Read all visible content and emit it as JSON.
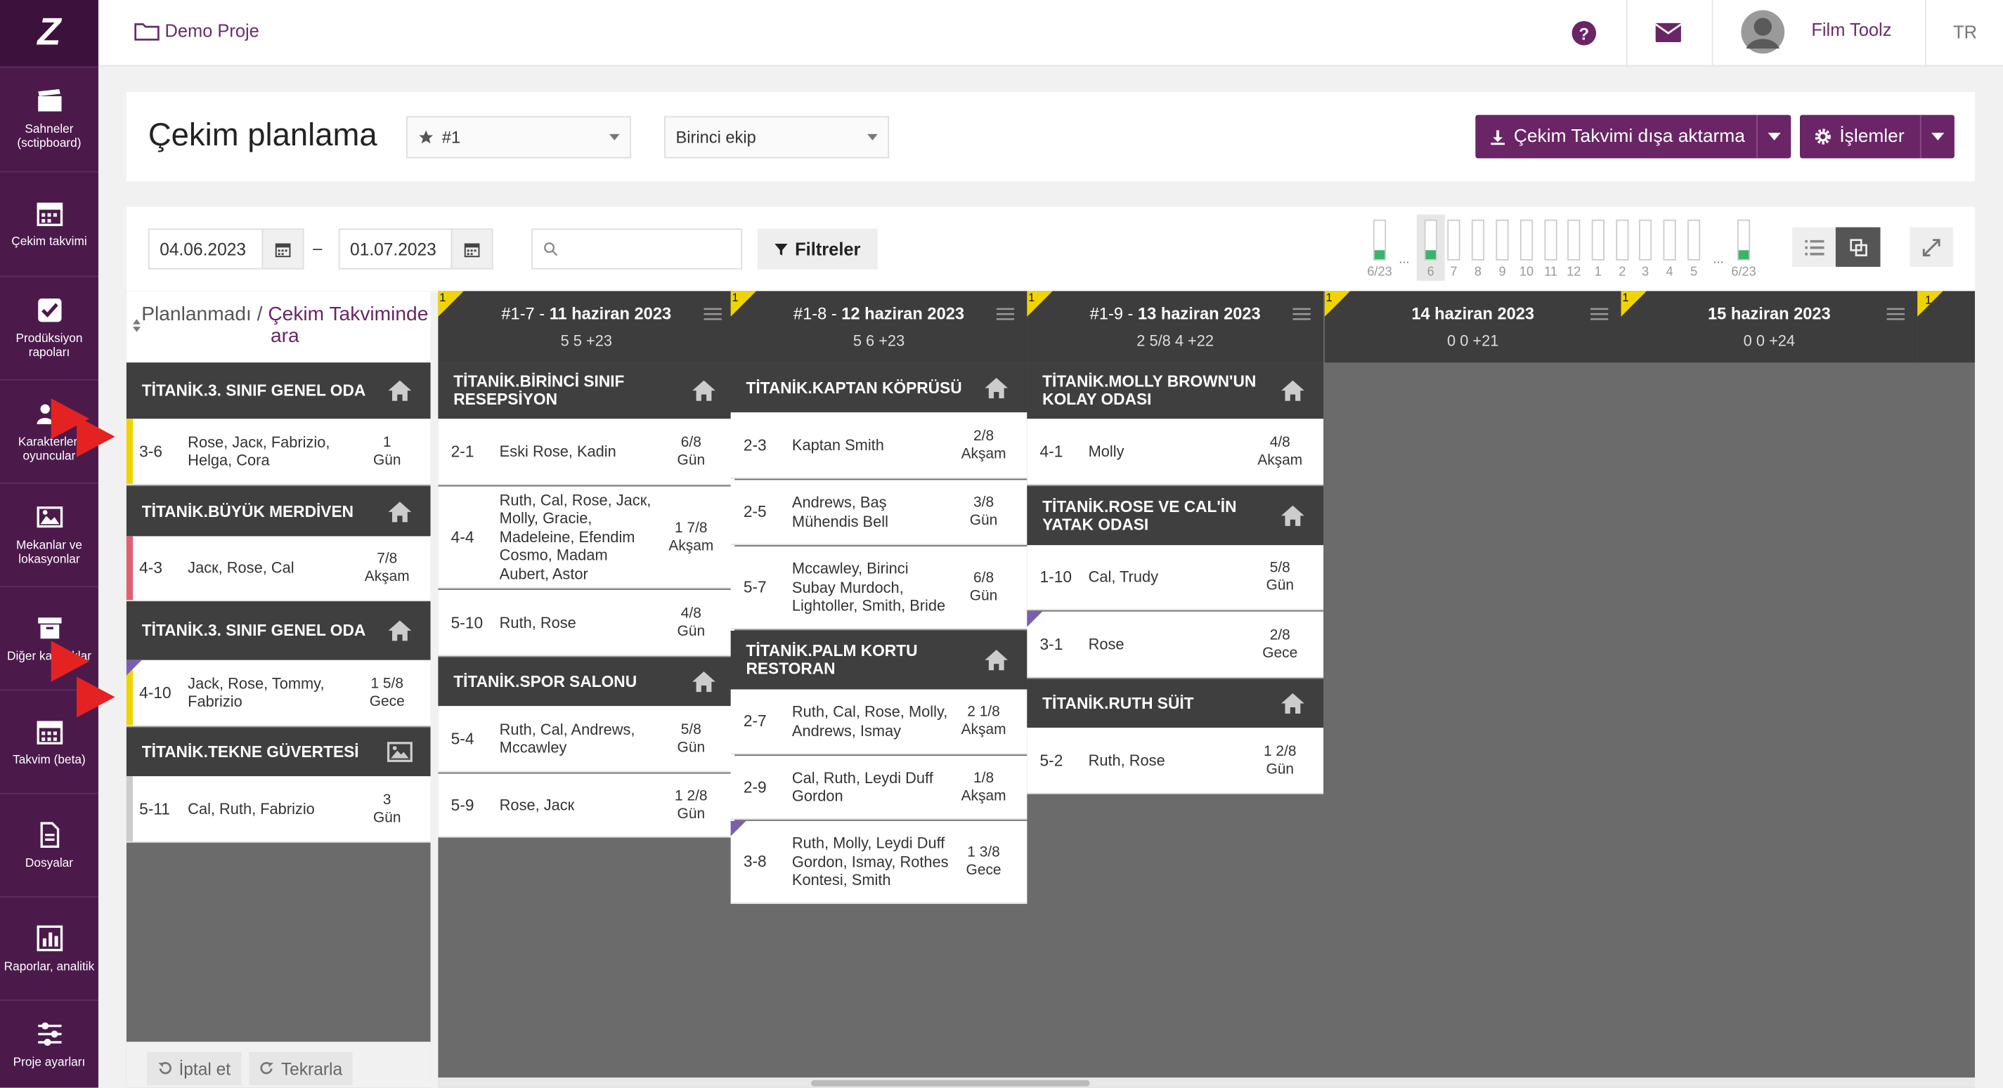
{
  "sidebar": {
    "logo": "Z",
    "items": [
      {
        "label": "Sahneler (sctipboard)",
        "icon": "clapper-icon"
      },
      {
        "label": "Çekim takvimi",
        "icon": "calendar-icon"
      },
      {
        "label": "Prodüksiyon rapoları",
        "icon": "check-icon"
      },
      {
        "label": "Karakterler, oyuncular",
        "icon": "people-icon"
      },
      {
        "label": "Mekanlar ve lokasyonlar",
        "icon": "image-icon"
      },
      {
        "label": "Diğer kaynaklar",
        "icon": "archive-icon"
      },
      {
        "label": "Takvim (beta)",
        "icon": "calendar-grid-icon"
      },
      {
        "label": "Dosyalar",
        "icon": "file-icon"
      },
      {
        "label": "Raporlar, analitik",
        "icon": "chart-icon"
      },
      {
        "label": "Proje ayarları",
        "icon": "sliders-icon"
      }
    ]
  },
  "topbar": {
    "project": "Demo Proje",
    "user": "Film Toolz",
    "lang": "TR"
  },
  "header": {
    "title": "Çekim planlama",
    "select1": "#1",
    "select2": "Birinci ekip",
    "export_label": "Çekim Takvimi dışa aktarma",
    "ops_label": "İşlemler"
  },
  "toolbar": {
    "date_from": "04.06.2023",
    "date_to": "01.07.2023",
    "dash": "–",
    "search_placeholder": "",
    "filter_label": "Filtreler",
    "mini": {
      "left_label": "6/23",
      "right_label": "6/23",
      "dots": "...",
      "nums": [
        "6",
        "7",
        "8",
        "9",
        "10",
        "11",
        "12",
        "1",
        "2",
        "3",
        "4",
        "5"
      ]
    }
  },
  "left": {
    "title_a": "Planlanmadı / ",
    "title_b": "Çekim Takviminde ara",
    "cancel": "İptal et",
    "repeat": "Tekrarla",
    "sets": [
      {
        "name": "TİTANİK.3. SINIF GENEL ODA",
        "icon": "home-icon",
        "scenes": [
          {
            "no": "3-6",
            "chars": "Rose, Jacк, Fabrizio, Helga, Cora",
            "len": "1",
            "time": "Gün",
            "color": "#f0d400"
          }
        ]
      },
      {
        "name": "TİTANİK.BÜYÜK MERDİVEN",
        "icon": "home-icon",
        "scenes": [
          {
            "no": "4-3",
            "chars": "Jacк, Rose, Cal",
            "len": "7/8",
            "time": "Akşam",
            "color": "#e06070"
          }
        ]
      },
      {
        "name": "TİTANİK.3. SINIF GENEL ODA",
        "icon": "home-icon",
        "scenes": [
          {
            "no": "4-10",
            "chars": "Jack, Rose, Tommy, Fabrizio",
            "len": "1 5/8",
            "time": "Gece",
            "color": "#f0d400"
          }
        ]
      },
      {
        "name": "TİTANİK.TEKNE GÜVERTESİ",
        "icon": "image-icon",
        "scenes": [
          {
            "no": "5-11",
            "chars": "Cal, Ruth, Fabrizio",
            "len": "3",
            "time": "Gün",
            "color": "#ccc"
          }
        ]
      }
    ]
  },
  "columns": [
    {
      "flag": "1",
      "prefix": "#1-7 - ",
      "date": "11 haziran 2023",
      "stats": "5  5  +23",
      "sets": [
        {
          "name": "TİTANİK.BİRİNCİ SINIF RESEPSİYON",
          "scenes": [
            {
              "no": "2-1",
              "chars": "Eski Rose, Kadin",
              "len": "6/8",
              "time": "Gün"
            },
            {
              "no": "4-4",
              "chars": "Ruth, Cal, Rose, Jacк, Molly, Gracie, Madeleine, Efendim Cosmo, Madam Aubert, Astor",
              "len": "1 7/8",
              "time": "Akşam"
            },
            {
              "no": "5-10",
              "chars": "Ruth, Rose",
              "len": "4/8",
              "time": "Gün"
            }
          ]
        },
        {
          "name": "TİTANİK.SPOR SALONU",
          "scenes": [
            {
              "no": "5-4",
              "chars": "Ruth, Cal, Andrews, Mccawley",
              "len": "5/8",
              "time": "Gün"
            },
            {
              "no": "5-9",
              "chars": "Rose, Jacк",
              "len": "1 2/8",
              "time": "Gün"
            }
          ]
        }
      ]
    },
    {
      "flag": "1",
      "prefix": "#1-8 - ",
      "date": "12 haziran 2023",
      "stats": "5  6  +23",
      "sets": [
        {
          "name": "TİTANİK.KAPTAN KÖPRÜSÜ",
          "scenes": [
            {
              "no": "2-3",
              "chars": "Kaptan Smith",
              "len": "2/8",
              "time": "Akşam"
            },
            {
              "no": "2-5",
              "chars": "Andrews, Baş Mühendis Bell",
              "len": "3/8",
              "time": "Gün"
            },
            {
              "no": "5-7",
              "chars": "Mccawley, Birinci Subay Murdoch, Lightoller, Smith, Bride",
              "len": "6/8",
              "time": "Gün"
            }
          ]
        },
        {
          "name": "TİTANİK.PALM KORTU RESTORAN",
          "scenes": [
            {
              "no": "2-7",
              "chars": "Ruth, Cal, Rose, Molly, Andrews, Ismay",
              "len": "2 1/8",
              "time": "Akşam"
            },
            {
              "no": "2-9",
              "chars": "Cal, Ruth, Leydi Duff Gordon",
              "len": "1/8",
              "time": "Akşam"
            },
            {
              "no": "3-8",
              "chars": "Ruth, Molly, Leydi Duff Gordon, Ismay, Rothes Kontesi, Smith",
              "len": "1 3/8",
              "time": "Gece"
            }
          ]
        }
      ]
    },
    {
      "flag": "1",
      "prefix": "#1-9 - ",
      "date": "13 haziran 2023",
      "stats": "2 5/8  4  +22",
      "sets": [
        {
          "name": "TİTANİK.MOLLY BROWN'UN KOLAY ODASI",
          "scenes": [
            {
              "no": "4-1",
              "chars": "Molly",
              "len": "4/8",
              "time": "Akşam"
            }
          ]
        },
        {
          "name": "TİTANİK.ROSE VE CAL'İN YATAK ODASI",
          "scenes": [
            {
              "no": "1-10",
              "chars": "Cal, Trudy",
              "len": "5/8",
              "time": "Gün"
            },
            {
              "no": "3-1",
              "chars": "Rose",
              "len": "2/8",
              "time": "Gece"
            }
          ]
        },
        {
          "name": "TİTANİK.RUTH SÜİT",
          "scenes": [
            {
              "no": "5-2",
              "chars": "Ruth, Rose",
              "len": "1 2/8",
              "time": "Gün"
            }
          ]
        }
      ]
    },
    {
      "flag": "1",
      "prefix": "",
      "date": "14 haziran 2023",
      "stats": "0  0  +21",
      "sets": []
    },
    {
      "flag": "1",
      "prefix": "",
      "date": "15 haziran 2023",
      "stats": "0  0  +24",
      "sets": []
    }
  ],
  "extra_flag": "1"
}
